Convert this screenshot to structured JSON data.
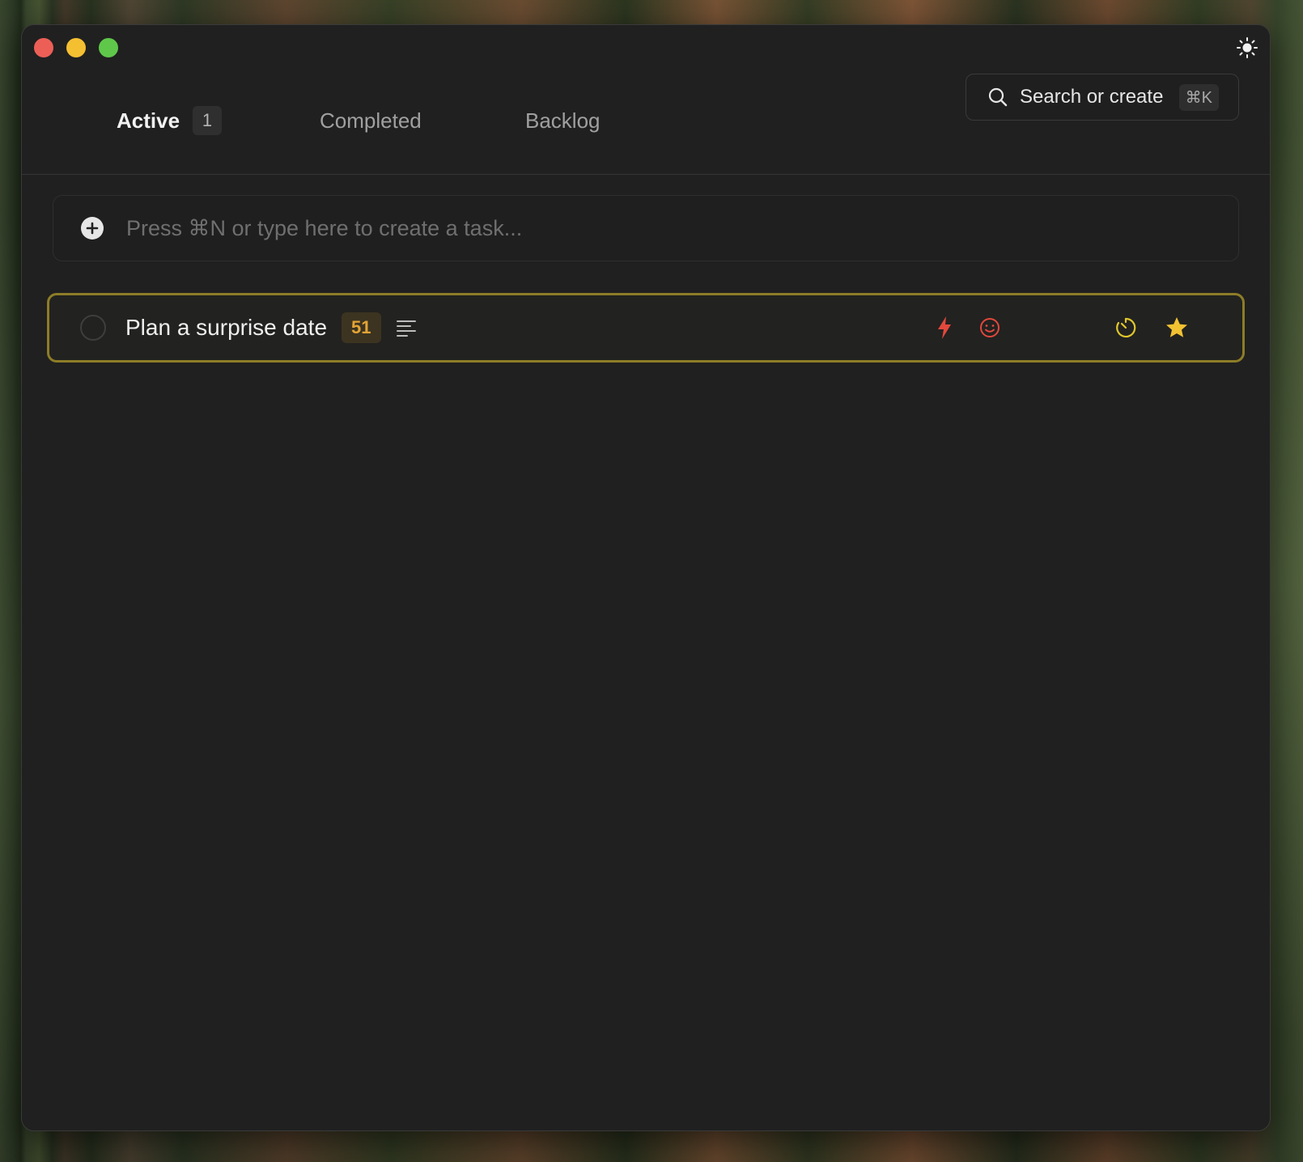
{
  "tabs": [
    {
      "label": "Active",
      "count": "1"
    },
    {
      "label": "Completed"
    },
    {
      "label": "Backlog"
    }
  ],
  "search": {
    "label": "Search or create",
    "shortcut": "⌘K"
  },
  "create": {
    "placeholder": "Press ⌘N or type here to create a task..."
  },
  "task": {
    "title": "Plan a surprise date",
    "score": "51",
    "icons": [
      "lightning-icon",
      "smiley-icon",
      "timer-icon",
      "star-icon"
    ]
  },
  "colors": {
    "accent_border": "#8d7d27",
    "score_text": "#e3a436",
    "lightning": "#e2483d",
    "smiley": "#e2483d",
    "timer": "#e0c62c",
    "star": "#f3c232"
  }
}
